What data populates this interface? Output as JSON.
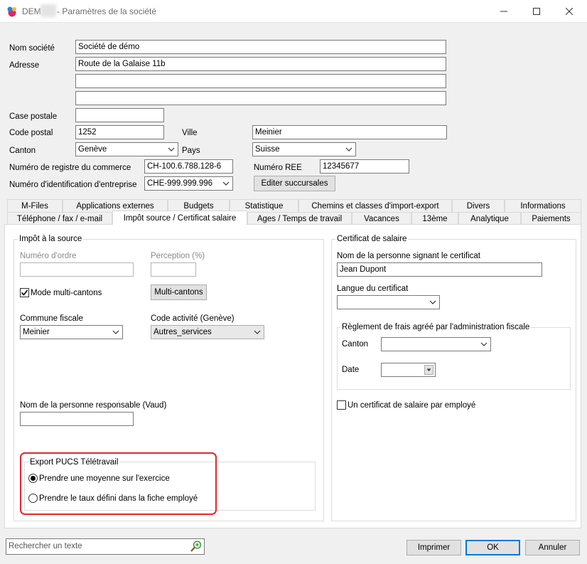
{
  "window": {
    "title_prefix": "DEM",
    "title_suffix": "- Paramètres de la société",
    "minimize_icon": "minimize-icon",
    "maximize_icon": "maximize-icon",
    "close_icon": "close-icon"
  },
  "company": {
    "name_label": "Nom société",
    "name_value": "Société de démo",
    "address_label": "Adresse",
    "address_line1": "Route de la Galaise 11b",
    "address_line2": "",
    "address_line3": "",
    "pobox_label": "Case postale",
    "pobox_value": "",
    "zip_label": "Code postal",
    "zip_value": "1252",
    "city_label": "Ville",
    "city_value": "Meinier",
    "canton_label": "Canton",
    "canton_value": "Genève",
    "country_label": "Pays",
    "country_value": "Suisse",
    "register_label": "Numéro de registre du commerce",
    "register_value": "CH-100.6.788.128-6",
    "ree_label": "Numéro REE",
    "ree_value": "12345677",
    "ide_label": "Numéro d'identification d'entreprise",
    "ide_value": "CHE-999.999.996",
    "branches_button": "Editer succursales"
  },
  "tabs_row1": [
    "M-Files",
    "Applications externes",
    "Budgets",
    "Statistique",
    "Chemins et classes d'import-export",
    "Divers",
    "Informations"
  ],
  "tabs_row2": [
    "Téléphone / fax / e-mail",
    "Impôt source / Certificat salaire",
    "Ages / Temps de travail",
    "Vacances",
    "13ème",
    "Analytique",
    "Paiements"
  ],
  "source_tax": {
    "group_title": "Impôt à la source",
    "order_label": "Numéro d'ordre",
    "order_value": "",
    "perception_label": "Perception (%)",
    "perception_value": "",
    "multi_canton_label": "Mode multi-cantons",
    "multi_canton_checked": true,
    "multi_canton_button": "Multi-cantons",
    "commune_label": "Commune fiscale",
    "commune_value": "Meinier",
    "activity_label": "Code activité (Genève)",
    "activity_value": "Autres_services",
    "responsible_label": "Nom de la personne responsable (Vaud)",
    "responsible_value": ""
  },
  "pucs": {
    "group_title": "Export PUCS Télétravail",
    "option1": "Prendre une moyenne sur l'exercice",
    "option2": "Prendre le taux défini dans la fiche employé",
    "selected": 1
  },
  "certificate": {
    "group_title": "Certificat de salaire",
    "signer_label": "Nom de la personne signant le certificat",
    "signer_value": "Jean Dupont",
    "language_label": "Langue du certificat",
    "language_value": "",
    "rules_title": "Règlement de frais agréé par l'administration fiscale",
    "rules_canton_label": "Canton",
    "rules_canton_value": "",
    "rules_date_label": "Date",
    "rules_date_value": " .  .",
    "one_per_employee_label": "Un certificat de salaire par employé",
    "one_per_employee_checked": false
  },
  "footer": {
    "search_placeholder": "Rechercher un texte",
    "search_icon": "search-icon",
    "print_button": "Imprimer",
    "ok_button": "OK",
    "cancel_button": "Annuler"
  },
  "colors": {
    "highlight": "#e3262e",
    "accent": "#0078d7"
  }
}
